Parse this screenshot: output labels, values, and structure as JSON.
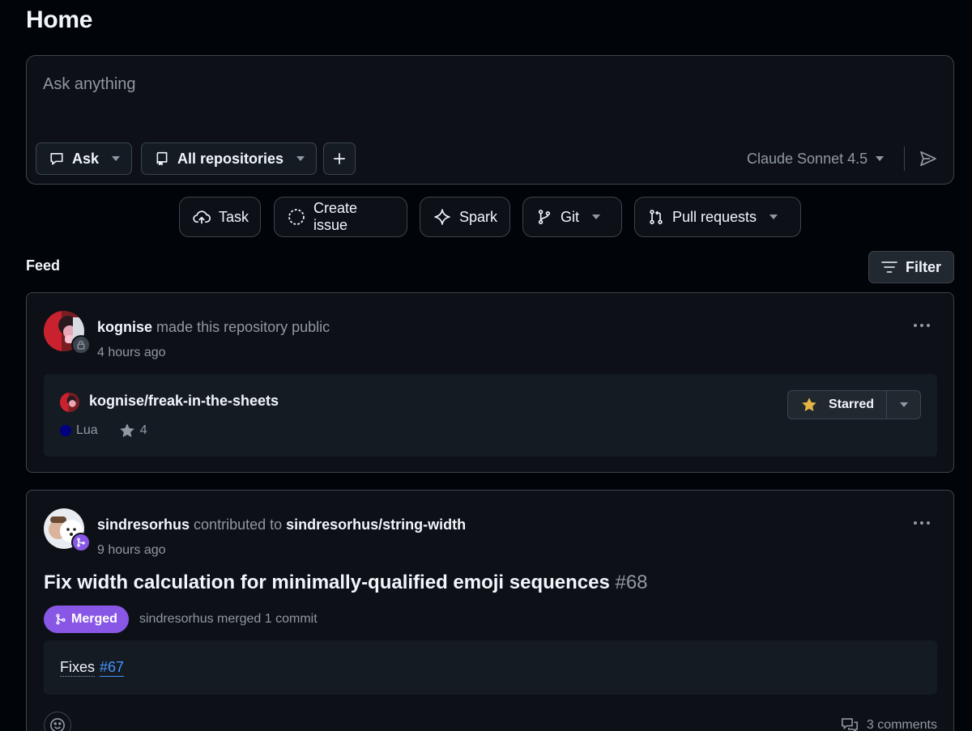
{
  "page": {
    "title": "Home"
  },
  "composer": {
    "placeholder": "Ask anything",
    "mode_label": "Ask",
    "repo_scope_label": "All repositories",
    "model_label": "Claude Sonnet 4.5"
  },
  "quick_actions": [
    {
      "label": "Task",
      "icon": "cloud-upload-icon"
    },
    {
      "label": "Create issue",
      "icon": "issue-dashed-circle-icon"
    },
    {
      "label": "Spark",
      "icon": "sparkle-icon"
    },
    {
      "label": "Git",
      "icon": "git-branch-icon"
    },
    {
      "label": "Pull requests",
      "icon": "git-pull-request-icon"
    }
  ],
  "feed": {
    "label": "Feed",
    "filter_label": "Filter",
    "items": [
      {
        "actor": "kognise",
        "action": "made this repository public",
        "time": "4 hours ago",
        "repo": {
          "full_name": "kognise/freak-in-the-sheets",
          "language": "Lua",
          "language_color": "#000080",
          "stars": "4",
          "star_button_label": "Starred"
        }
      },
      {
        "actor": "sindresorhus",
        "action": "contributed to",
        "target": "sindresorhus/string-width",
        "time": "9 hours ago",
        "pr": {
          "title": "Fix width calculation for minimally-qualified emoji sequences",
          "number": "#68",
          "status": "Merged",
          "merge_summary": "sindresorhus merged 1 commit",
          "body_prefix": "Fixes",
          "body_link": "#67"
        },
        "comments_label": "3 comments"
      }
    ]
  },
  "colors": {
    "background": "#010409",
    "card": "#0d1117",
    "border": "#3d444d",
    "merged": "#8957e5",
    "link": "#4493f8",
    "star": "#e3b341"
  }
}
